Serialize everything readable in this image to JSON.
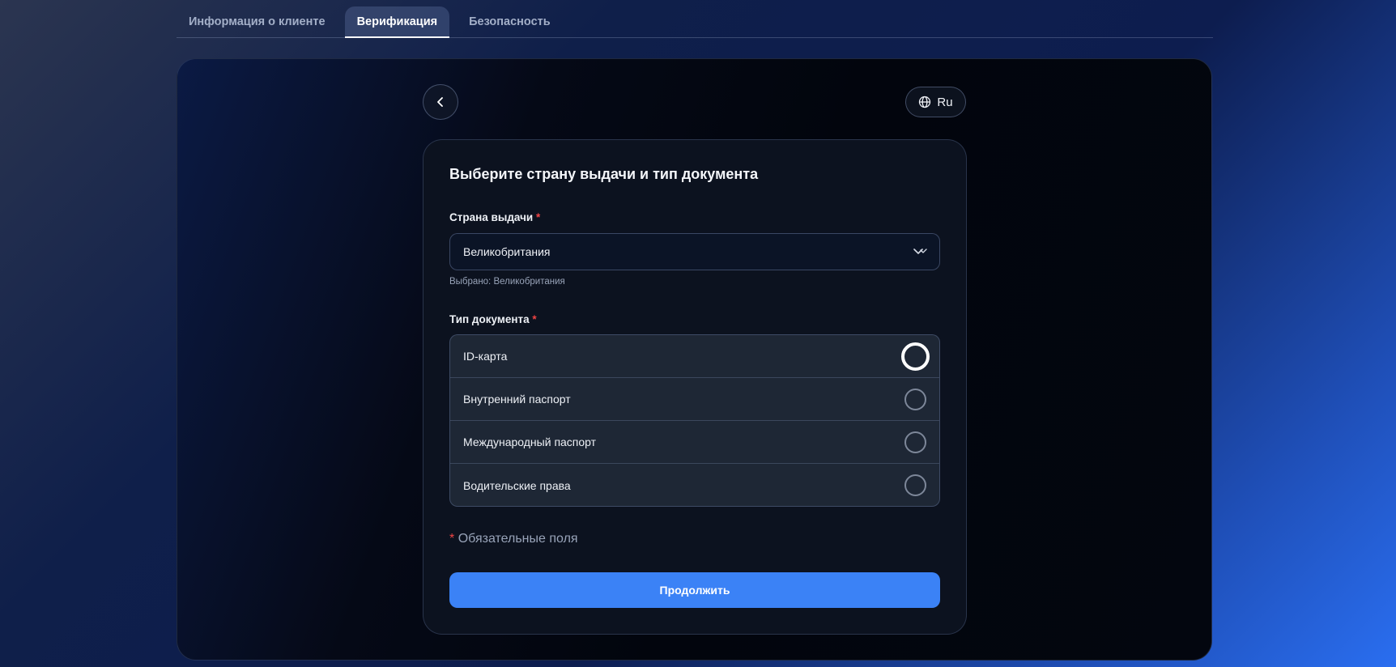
{
  "tabs": [
    {
      "label": "Информация о клиенте",
      "active": false
    },
    {
      "label": "Верификация",
      "active": true
    },
    {
      "label": "Безопасность",
      "active": false
    }
  ],
  "header": {
    "language": "Ru"
  },
  "form": {
    "title": "Выберите страну выдачи и тип документа",
    "country_label": "Страна выдачи",
    "required_mark": "*",
    "country_value": "Великобритания",
    "country_hint": "Выбрано: Великобритания",
    "doc_type_label": "Тип документа",
    "doc_types": [
      {
        "label": "ID-карта",
        "focused": true
      },
      {
        "label": "Внутренний паспорт",
        "focused": false
      },
      {
        "label": "Международный паспорт",
        "focused": false
      },
      {
        "label": "Водительские права",
        "focused": false
      }
    ],
    "required_note": "Обязательные поля",
    "continue_label": "Продолжить"
  },
  "colors": {
    "accent": "#3b82f6",
    "required": "#ef4444",
    "card_bg": "#0c121f"
  }
}
